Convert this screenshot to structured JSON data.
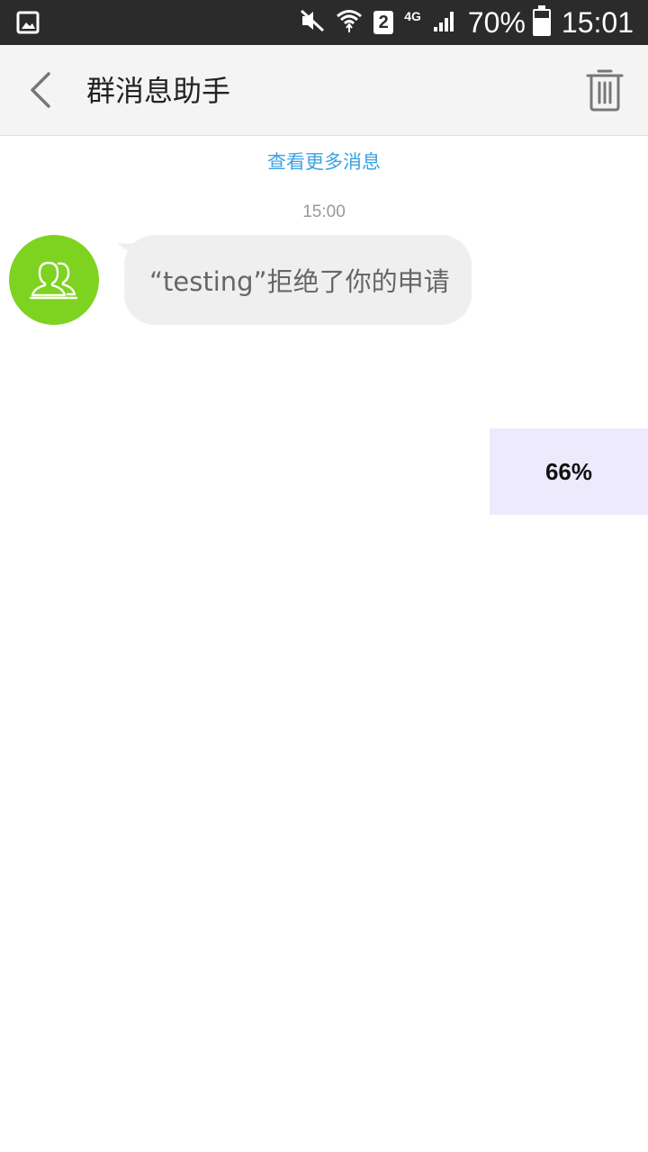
{
  "status_bar": {
    "battery_percent_text": "70%",
    "battery_level": 0.7,
    "time": "15:01",
    "sim_slot": "2",
    "network_type": "4G",
    "icons": [
      "gallery-icon",
      "mute-icon",
      "wifi-icon",
      "sim-icon",
      "signal-icon",
      "battery-icon"
    ]
  },
  "header": {
    "title": "群消息助手",
    "icons": [
      "back-arrow-icon",
      "trash-icon"
    ]
  },
  "chat": {
    "view_more_label": "查看更多消息",
    "timestamp": "15:00",
    "messages": [
      {
        "text": "“testing”拒绝了你的申请",
        "avatar_icon": "group-icon"
      }
    ]
  },
  "overlay": {
    "percent_label": "66%"
  },
  "colors": {
    "status_bar_bg": "#2b2b2b",
    "header_bg": "#f4f4f4",
    "link": "#3aa3e3",
    "avatar_bg": "#7ed321",
    "bubble_bg": "#efefef",
    "overlay_bg": "#eeeafd"
  }
}
